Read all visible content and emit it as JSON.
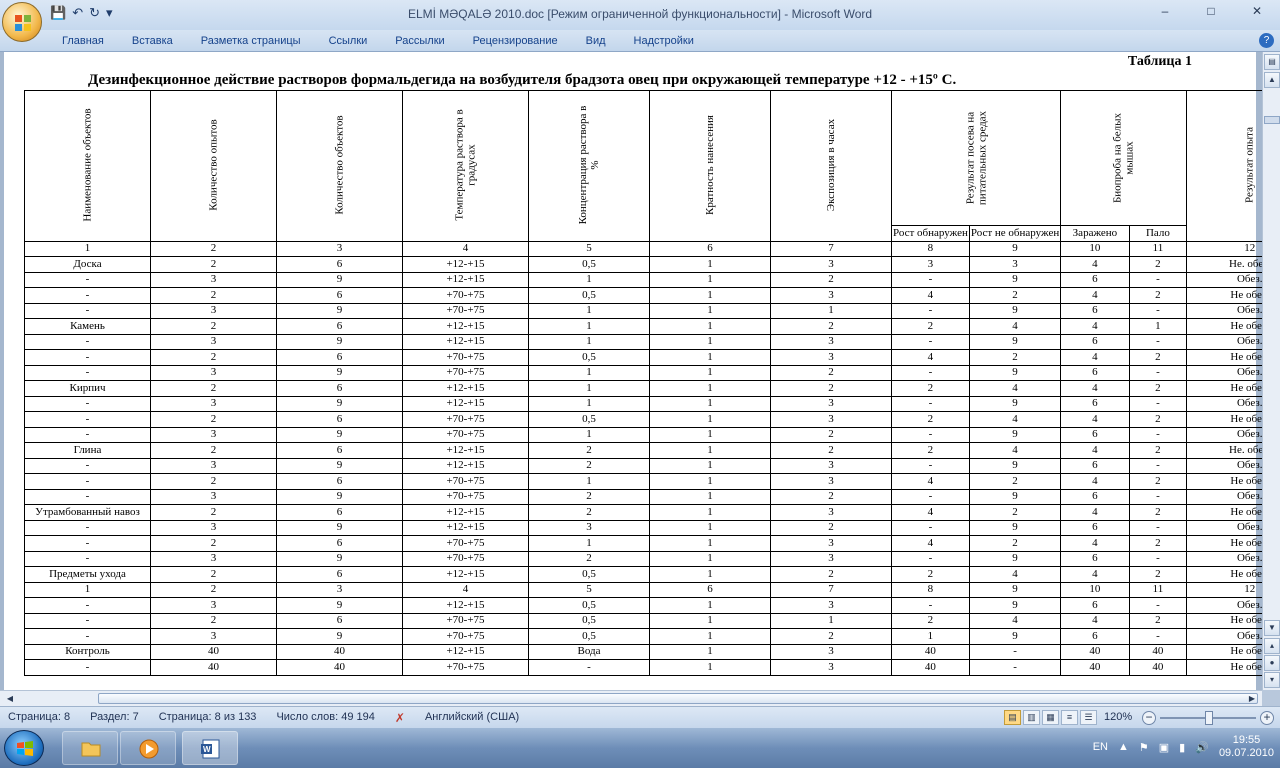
{
  "window": {
    "title": "ELMİ MƏQALƏ 2010.doc [Режим ограниченной функциональности] - Microsoft Word",
    "minimize": "‒",
    "maximize": "□",
    "close": "✕"
  },
  "ribbon": {
    "tabs": [
      "Главная",
      "Вставка",
      "Разметка страницы",
      "Ссылки",
      "Рассылки",
      "Рецензирование",
      "Вид",
      "Надстройки"
    ],
    "help": "?"
  },
  "document": {
    "table_number": "Таблица 1",
    "table_title": "Дезинфекционное действие растворов формальдегида на возбудителя брадзота овец при окружающей температуре +12 - +15º С.",
    "headers": {
      "object": "Наименование объектов",
      "experiments": "Количество опытов",
      "objects_count": "Количество объектов",
      "temperature": "Температура раствора в градусах",
      "concentration": "Концентрация раствора в %",
      "multiplicity": "Кратность нанесения",
      "exposure": "Экспозиция в часах",
      "culture": "Результат посева на питательных средах",
      "culture_growth": "Рост обнаружен",
      "culture_no_growth": "Рост не обнаружен",
      "bioassay": "Биопроба на белых мышах",
      "bio_infected": "Заражено",
      "bio_died": "Пало",
      "result": "Результат опыта"
    },
    "column_numbers": [
      "1",
      "2",
      "3",
      "4",
      "5",
      "6",
      "7",
      "8",
      "9",
      "10",
      "11",
      "12"
    ],
    "rows": [
      [
        "Доска",
        "2",
        "6",
        "+12-+15",
        "0,5",
        "1",
        "3",
        "3",
        "3",
        "4",
        "2",
        "Не. обез."
      ],
      [
        "-",
        "3",
        "9",
        "+12-+15",
        "1",
        "1",
        "2",
        "-",
        "9",
        "6",
        "-",
        "Обез."
      ],
      [
        "-",
        "2",
        "6",
        "+70-+75",
        "0,5",
        "1",
        "3",
        "4",
        "2",
        "4",
        "2",
        "Не обез."
      ],
      [
        "-",
        "3",
        "9",
        "+70-+75",
        "1",
        "1",
        "1",
        "-",
        "9",
        "6",
        "-",
        "Обез."
      ],
      [
        "Камень",
        "2",
        "6",
        "+12-+15",
        "1",
        "1",
        "2",
        "2",
        "4",
        "4",
        "1",
        "Не обез."
      ],
      [
        "-",
        "3",
        "9",
        "+12-+15",
        "1",
        "1",
        "3",
        "-",
        "9",
        "6",
        "-",
        "Обез."
      ],
      [
        "-",
        "2",
        "6",
        "+70-+75",
        "0,5",
        "1",
        "3",
        "4",
        "2",
        "4",
        "2",
        "Не обез."
      ],
      [
        "-",
        "3",
        "9",
        "+70-+75",
        "1",
        "1",
        "2",
        "-",
        "9",
        "6",
        "-",
        "Обез."
      ],
      [
        "Кирпич",
        "2",
        "6",
        "+12-+15",
        "1",
        "1",
        "2",
        "2",
        "4",
        "4",
        "2",
        "Не обез."
      ],
      [
        "-",
        "3",
        "9",
        "+12-+15",
        "1",
        "1",
        "3",
        "-",
        "9",
        "6",
        "-",
        "Обез."
      ],
      [
        "-",
        "2",
        "6",
        "+70-+75",
        "0,5",
        "1",
        "3",
        "2",
        "4",
        "4",
        "2",
        "Не обез."
      ],
      [
        "-",
        "3",
        "9",
        "+70-+75",
        "1",
        "1",
        "2",
        "-",
        "9",
        "6",
        "-",
        "Обез."
      ],
      [
        "Глина",
        "2",
        "6",
        "+12-+15",
        "2",
        "1",
        "2",
        "2",
        "4",
        "4",
        "2",
        "Не. обез."
      ],
      [
        "-",
        "3",
        "9",
        "+12-+15",
        "2",
        "1",
        "3",
        "-",
        "9",
        "6",
        "-",
        "Обез."
      ],
      [
        "-",
        "2",
        "6",
        "+70-+75",
        "1",
        "1",
        "3",
        "4",
        "2",
        "4",
        "2",
        "Не обез."
      ],
      [
        "-",
        "3",
        "9",
        "+70-+75",
        "2",
        "1",
        "2",
        "-",
        "9",
        "6",
        "-",
        "Обез."
      ],
      [
        "Утрамбованный навоз",
        "2",
        "6",
        "+12-+15",
        "2",
        "1",
        "3",
        "4",
        "2",
        "4",
        "2",
        "Не обез."
      ],
      [
        "-",
        "3",
        "9",
        "+12-+15",
        "3",
        "1",
        "2",
        "-",
        "9",
        "6",
        "-",
        "Обез."
      ],
      [
        "-",
        "2",
        "6",
        "+70-+75",
        "1",
        "1",
        "3",
        "4",
        "2",
        "4",
        "2",
        "Не обез."
      ],
      [
        "-",
        "3",
        "9",
        "+70-+75",
        "2",
        "1",
        "3",
        "-",
        "9",
        "6",
        "-",
        "Обез."
      ],
      [
        "Предметы ухода",
        "2",
        "6",
        "+12-+15",
        "0,5",
        "1",
        "2",
        "2",
        "4",
        "4",
        "2",
        "Не обез."
      ],
      [
        "1",
        "2",
        "3",
        "4",
        "5",
        "6",
        "7",
        "8",
        "9",
        "10",
        "11",
        "12"
      ],
      [
        "-",
        "3",
        "9",
        "+12-+15",
        "0,5",
        "1",
        "3",
        "-",
        "9",
        "6",
        "-",
        "Обез."
      ],
      [
        "-",
        "2",
        "6",
        "+70-+75",
        "0,5",
        "1",
        "1",
        "2",
        "4",
        "4",
        "2",
        "Не обез."
      ],
      [
        "-",
        "3",
        "9",
        "+70-+75",
        "0,5",
        "1",
        "2",
        "1",
        "9",
        "6",
        "-",
        "Обез."
      ],
      [
        "Контроль",
        "40",
        "40",
        "+12-+15",
        "Вода",
        "1",
        "3",
        "40",
        "-",
        "40",
        "40",
        "Не обез."
      ],
      [
        "-",
        "40",
        "40",
        "+70-+75",
        "-",
        "1",
        "3",
        "40",
        "-",
        "40",
        "40",
        "Не обез."
      ]
    ]
  },
  "status": {
    "page": "Страница: 8",
    "section": "Раздел: 7",
    "pages": "Страница: 8 из 133",
    "words": "Число слов: 49 194",
    "language": "Английский (США)",
    "zoom": "120%"
  },
  "taskbar": {
    "language": "EN",
    "time": "19:55",
    "date": "09.07.2010"
  }
}
